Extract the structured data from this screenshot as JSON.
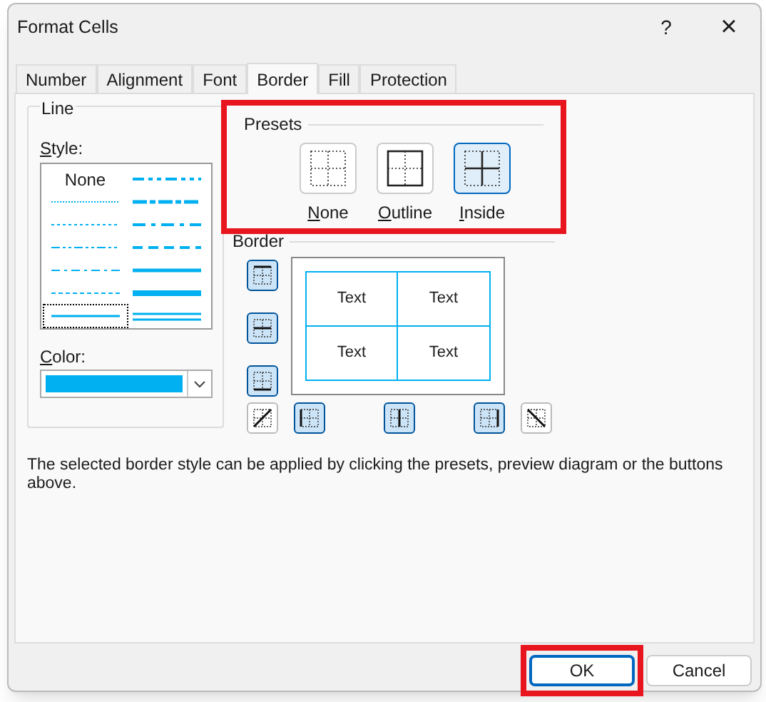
{
  "window": {
    "title": "Format Cells",
    "help": "?",
    "close": "×"
  },
  "tabs": [
    {
      "label": "Number",
      "selected": false
    },
    {
      "label": "Alignment",
      "selected": false
    },
    {
      "label": "Font",
      "selected": false
    },
    {
      "label": "Border",
      "selected": true
    },
    {
      "label": "Fill",
      "selected": false
    },
    {
      "label": "Protection",
      "selected": false
    }
  ],
  "line": {
    "title": "Line",
    "style_label": "Style:",
    "style_label_underline_first": true,
    "styles_left": [
      {
        "kind": "none",
        "label": "None",
        "selected": false
      },
      {
        "kind": "hair",
        "selected": false
      },
      {
        "kind": "dotted",
        "selected": false
      },
      {
        "kind": "dash-dot-dot",
        "selected": false
      },
      {
        "kind": "dash-dot",
        "selected": false
      },
      {
        "kind": "dashed",
        "selected": false
      },
      {
        "kind": "thin",
        "selected": true
      }
    ],
    "styles_right": [
      {
        "kind": "medium-dash-dot-dot",
        "selected": false
      },
      {
        "kind": "slanted-dash-dot",
        "selected": false
      },
      {
        "kind": "medium-dash-dot",
        "selected": false
      },
      {
        "kind": "medium-dashed",
        "selected": false
      },
      {
        "kind": "medium",
        "selected": false
      },
      {
        "kind": "thick",
        "selected": false
      },
      {
        "kind": "double",
        "selected": false
      }
    ],
    "color_label": "Color:",
    "color_label_underline_first": true,
    "color": "#00b0f0"
  },
  "presets": {
    "title": "Presets",
    "highlight": true,
    "items": [
      {
        "kind": "none",
        "label": "None",
        "underline_first": true,
        "selected": false
      },
      {
        "kind": "outline",
        "label": "Outline",
        "underline_first": true,
        "selected": false
      },
      {
        "kind": "inside",
        "label": "Inside",
        "underline_first": true,
        "selected": true
      }
    ]
  },
  "border": {
    "title": "Border",
    "left_buttons": [
      {
        "kind": "top",
        "pressed": true
      },
      {
        "kind": "inside-horizontal",
        "pressed": true
      },
      {
        "kind": "bottom",
        "pressed": true
      }
    ],
    "bottom_buttons": [
      {
        "kind": "diagonal-up",
        "pressed": false
      },
      {
        "kind": "left",
        "pressed": true
      },
      {
        "kind": "inside-vertical",
        "pressed": true
      },
      {
        "kind": "right",
        "pressed": true
      },
      {
        "kind": "diagonal-down",
        "pressed": false
      }
    ],
    "preview_cells": [
      "Text",
      "Text",
      "Text",
      "Text"
    ]
  },
  "description": "The selected border style can be applied by clicking the presets, preview diagram or the buttons above.",
  "buttons": [
    {
      "label": "OK",
      "default": true,
      "highlight": true
    },
    {
      "label": "Cancel",
      "default": false,
      "highlight": false
    }
  ]
}
